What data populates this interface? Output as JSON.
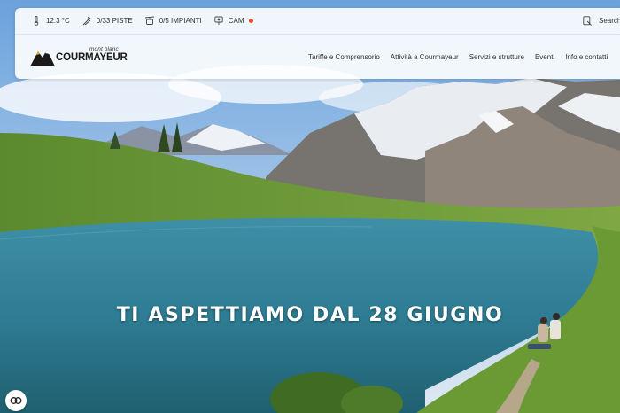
{
  "topbar": {
    "temperature": "12.3 °C",
    "slopes": "0/33 PISTE",
    "lifts": "0/5 IMPIANTI",
    "webcam": "CAM",
    "search": "Search"
  },
  "logo": {
    "small_text": "mont blanc",
    "big_text": "COURMAYEUR"
  },
  "nav": [
    "Tariffe e Comprensorio",
    "Attività a Courmayeur",
    "Servizi e strutture",
    "Eventi",
    "Info e contatti"
  ],
  "hero": {
    "headline": "TI ASPETTIAMO DAL 28 GIUGNO"
  },
  "icons": {
    "thermometer": "thermometer-icon",
    "ski": "ski-icon",
    "lift": "lift-icon",
    "webcam": "webcam-icon",
    "search": "search-icon",
    "cookie": "cookie-settings-icon"
  },
  "colors": {
    "cam_live": "#e8472a",
    "headline": "#ffffff",
    "lake": "#3f8fa8",
    "meadow": "#6f9a3a"
  }
}
